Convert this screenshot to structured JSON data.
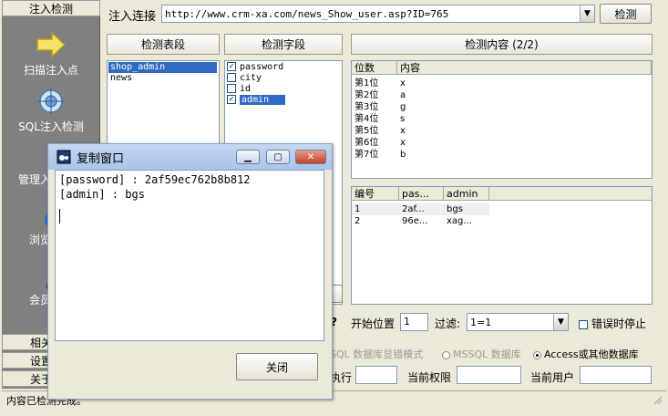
{
  "sidebar": {
    "header": "注入检测",
    "items": [
      {
        "label": "扫描注入点",
        "icon": "arrow-right-icon"
      },
      {
        "label": "SQL注入检测",
        "icon": "sql-injection-icon"
      },
      {
        "label": "管理入",
        "icon": "admin-icon"
      },
      {
        "label": "浏览",
        "icon": "browser-icon"
      },
      {
        "label": "会员",
        "icon": "member-icon"
      }
    ],
    "bottom_tabs": [
      "相关",
      "设置",
      "关于"
    ]
  },
  "toolbar": {
    "url_label": "注入连接",
    "url_value": "http://www.crm-xa.com/news_Show_user.asp?ID=765",
    "detect_button": "检测"
  },
  "panels": {
    "tables_header": "检测表段",
    "fields_header": "检测字段",
    "content_header": "检测内容 (2/2)"
  },
  "tables_list": [
    {
      "name": "shop_admin",
      "selected": true
    },
    {
      "name": "news",
      "selected": false
    }
  ],
  "fields_list": [
    {
      "name": "password",
      "checked": true,
      "selected": false
    },
    {
      "name": "city",
      "checked": false,
      "selected": false
    },
    {
      "name": "id",
      "checked": false,
      "selected": false
    },
    {
      "name": "admin",
      "checked": true,
      "selected": true
    }
  ],
  "position_grid": {
    "columns": [
      "位数",
      "内容"
    ],
    "rows": [
      [
        "第1位",
        "x"
      ],
      [
        "第2位",
        "a"
      ],
      [
        "第3位",
        "g"
      ],
      [
        "第4位",
        "s"
      ],
      [
        "第5位",
        "x"
      ],
      [
        "第6位",
        "x"
      ],
      [
        "第7位",
        "b"
      ]
    ]
  },
  "results_grid": {
    "columns": [
      "编号",
      "pas...",
      "admin"
    ],
    "rows": [
      [
        "1",
        "2af...",
        "bgs"
      ],
      [
        "2",
        "96e...",
        "xag..."
      ]
    ]
  },
  "options": {
    "question_mark": "?",
    "start_pos_label": "开始位置",
    "start_pos_value": "1",
    "filter_label": "过滤:",
    "filter_value": "1=1",
    "stop_on_error_label": "错误时停止",
    "radio_mssql_error": "SQL 数据库显错模式",
    "radio_mssql": "MSSQL 数据库",
    "radio_access": "Access或其他数据库",
    "execute_label": "执行",
    "current_perm_label": "当前权限",
    "current_user_label": "当前用户"
  },
  "status": {
    "text": "内容已检测完成。"
  },
  "dialog": {
    "title": "复制窗口",
    "lines": [
      "[password] : 2af59ec762b8b812",
      "[admin] : bgs"
    ],
    "close_button": "关闭"
  }
}
